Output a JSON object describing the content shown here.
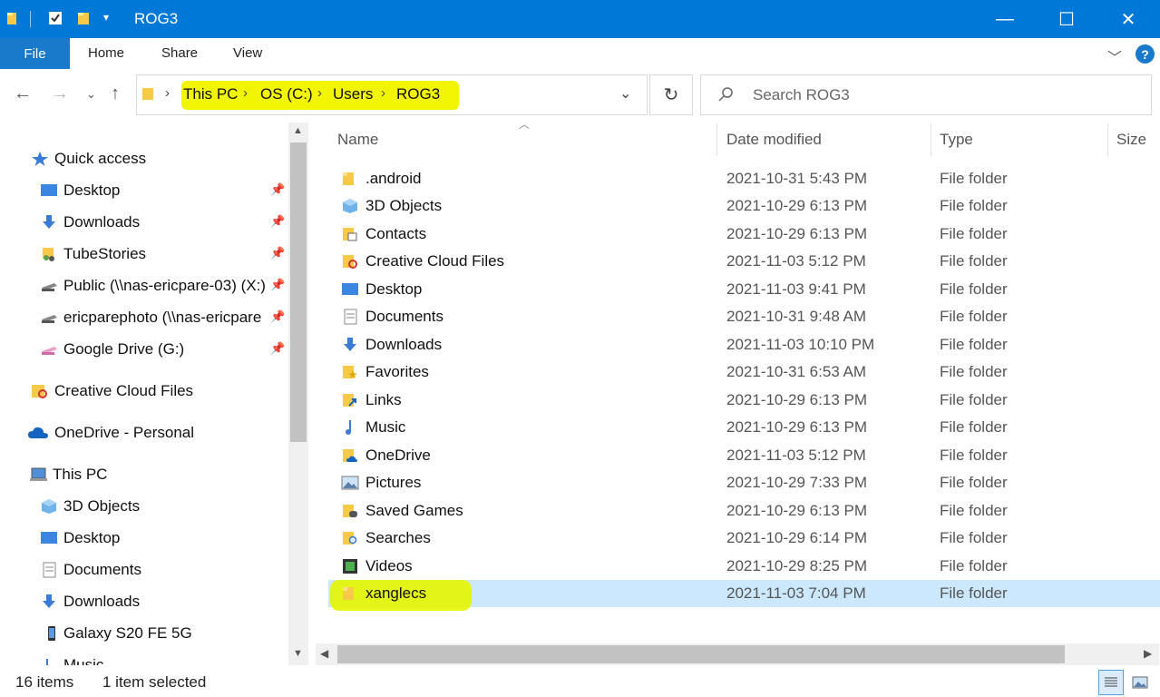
{
  "window": {
    "title": "ROG3",
    "minimize": "—",
    "maximize": "☐",
    "close": "✕",
    "accent": "#0078d7"
  },
  "ribbon": {
    "file": "File",
    "tabs": [
      "Home",
      "Share",
      "View"
    ],
    "help": "?"
  },
  "address": {
    "crumbs": [
      "This PC",
      "OS (C:)",
      "Users",
      "ROG3"
    ],
    "search_placeholder": "Search ROG3"
  },
  "nav": {
    "items": [
      {
        "label": "Quick access",
        "icon": "star-icon",
        "pinned": false
      },
      {
        "label": "Desktop",
        "icon": "desktop-icon",
        "pinned": true
      },
      {
        "label": "Downloads",
        "icon": "download-icon",
        "pinned": true
      },
      {
        "label": "TubeStories",
        "icon": "folder-people-icon",
        "pinned": true
      },
      {
        "label": "Public (\\\\nas-ericpare-03) (X:)",
        "icon": "network-drive-icon",
        "pinned": true
      },
      {
        "label": "ericparephoto (\\\\nas-ericpare",
        "icon": "network-drive-icon",
        "pinned": true
      },
      {
        "label": "Google Drive (G:)",
        "icon": "drive-icon",
        "pinned": true
      },
      {
        "label": "Creative Cloud Files",
        "icon": "creative-cloud-icon",
        "pinned": false
      },
      {
        "label": "OneDrive - Personal",
        "icon": "cloud-icon",
        "pinned": false
      },
      {
        "label": "This PC",
        "icon": "computer-icon",
        "pinned": false
      },
      {
        "label": "3D Objects",
        "icon": "cube-icon",
        "pinned": false
      },
      {
        "label": "Desktop",
        "icon": "desktop-icon",
        "pinned": false
      },
      {
        "label": "Documents",
        "icon": "document-icon",
        "pinned": false
      },
      {
        "label": "Downloads",
        "icon": "download-icon",
        "pinned": false
      },
      {
        "label": "Galaxy S20 FE 5G",
        "icon": "phone-icon",
        "pinned": false
      },
      {
        "label": "Music",
        "icon": "music-icon",
        "pinned": false
      }
    ]
  },
  "list": {
    "columns": {
      "name": "Name",
      "date": "Date modified",
      "type": "Type",
      "size": "Size"
    },
    "rows": [
      {
        "name": ".android",
        "date": "2021-10-31 5:43 PM",
        "type": "File folder",
        "icon": "folder-icon"
      },
      {
        "name": "3D Objects",
        "date": "2021-10-29 6:13 PM",
        "type": "File folder",
        "icon": "cube-icon"
      },
      {
        "name": "Contacts",
        "date": "2021-10-29 6:13 PM",
        "type": "File folder",
        "icon": "contacts-icon"
      },
      {
        "name": "Creative Cloud Files",
        "date": "2021-11-03 5:12 PM",
        "type": "File folder",
        "icon": "creative-cloud-icon"
      },
      {
        "name": "Desktop",
        "date": "2021-11-03 9:41 PM",
        "type": "File folder",
        "icon": "desktop-icon"
      },
      {
        "name": "Documents",
        "date": "2021-10-31 9:48 AM",
        "type": "File folder",
        "icon": "document-icon"
      },
      {
        "name": "Downloads",
        "date": "2021-11-03 10:10 PM",
        "type": "File folder",
        "icon": "download-icon"
      },
      {
        "name": "Favorites",
        "date": "2021-10-31 6:53 AM",
        "type": "File folder",
        "icon": "favorites-icon"
      },
      {
        "name": "Links",
        "date": "2021-10-29 6:13 PM",
        "type": "File folder",
        "icon": "link-icon"
      },
      {
        "name": "Music",
        "date": "2021-10-29 6:13 PM",
        "type": "File folder",
        "icon": "music-icon"
      },
      {
        "name": "OneDrive",
        "date": "2021-11-03 5:12 PM",
        "type": "File folder",
        "icon": "cloud-folder-icon"
      },
      {
        "name": "Pictures",
        "date": "2021-10-29 7:33 PM",
        "type": "File folder",
        "icon": "picture-icon"
      },
      {
        "name": "Saved Games",
        "date": "2021-10-29 6:13 PM",
        "type": "File folder",
        "icon": "games-icon"
      },
      {
        "name": "Searches",
        "date": "2021-10-29 6:14 PM",
        "type": "File folder",
        "icon": "search-folder-icon"
      },
      {
        "name": "Videos",
        "date": "2021-10-29 8:25 PM",
        "type": "File folder",
        "icon": "video-icon"
      },
      {
        "name": "xanglecs",
        "date": "2021-11-03 7:04 PM",
        "type": "File folder",
        "icon": "folder-icon",
        "selected": true
      }
    ]
  },
  "status": {
    "count": "16 items",
    "selection": "1 item selected"
  },
  "colors": {
    "highlight": "#f2f500",
    "selection": "#cce8ff"
  }
}
